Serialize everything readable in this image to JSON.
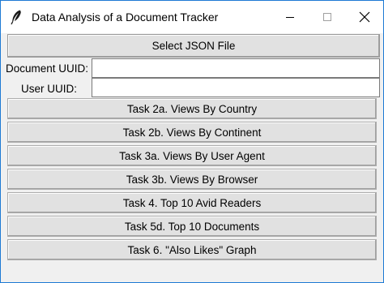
{
  "window": {
    "title": "Data Analysis of a Document Tracker",
    "icon": "feather-icon",
    "controls": [
      "minimize-icon",
      "maximize-icon",
      "close-icon"
    ]
  },
  "toolbar": {
    "select_json_label": "Select JSON File"
  },
  "fields": {
    "document_uuid": {
      "label": "Document UUID:",
      "value": "",
      "placeholder": ""
    },
    "user_uuid": {
      "label": "User UUID:",
      "value": "",
      "placeholder": ""
    }
  },
  "tasks": [
    {
      "label": "Task 2a. Views By Country"
    },
    {
      "label": "Task 2b. Views By Continent"
    },
    {
      "label": "Task 3a. Views By User Agent"
    },
    {
      "label": "Task 3b. Views By Browser"
    },
    {
      "label": "Task 4. Top 10 Avid Readers"
    },
    {
      "label": "Task 5d. Top 10 Documents"
    },
    {
      "label": "Task 6. \"Also Likes\" Graph"
    }
  ],
  "colors": {
    "window_border": "#1e7ad4",
    "title_bar": "#ffffff",
    "body_bg": "#f0f0f0",
    "button_bg": "#e1e1e1"
  }
}
